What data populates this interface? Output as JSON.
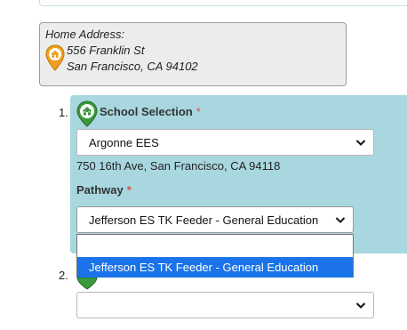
{
  "home": {
    "label": "Home Address:",
    "line1": "556 Franklin St",
    "line2": "San Francisco, CA 94102"
  },
  "section1": {
    "number": "1.",
    "title": "School Selection",
    "required_mark": "*",
    "school_select_value": "Argonne EES",
    "school_address": "750 16th Ave, San Francisco, CA 94118",
    "pathway_label": "Pathway",
    "pathway_required_mark": "*",
    "pathway_select_value": "Jefferson ES TK Feeder - General Education",
    "pathway_options": [
      "",
      "Jefferson ES TK Feeder - General Education"
    ]
  },
  "section2": {
    "number": "2.",
    "select_value": ""
  },
  "icons": {
    "home": "home-pin-icon",
    "school": "school-pin-icon",
    "chevron": "chevron-down-icon"
  },
  "colors": {
    "panel": "#a9d7e0",
    "home_pin": "#f0a020",
    "school_pin": "#3a9a3a",
    "highlight": "#1a73e8",
    "required": "#d9534f"
  }
}
